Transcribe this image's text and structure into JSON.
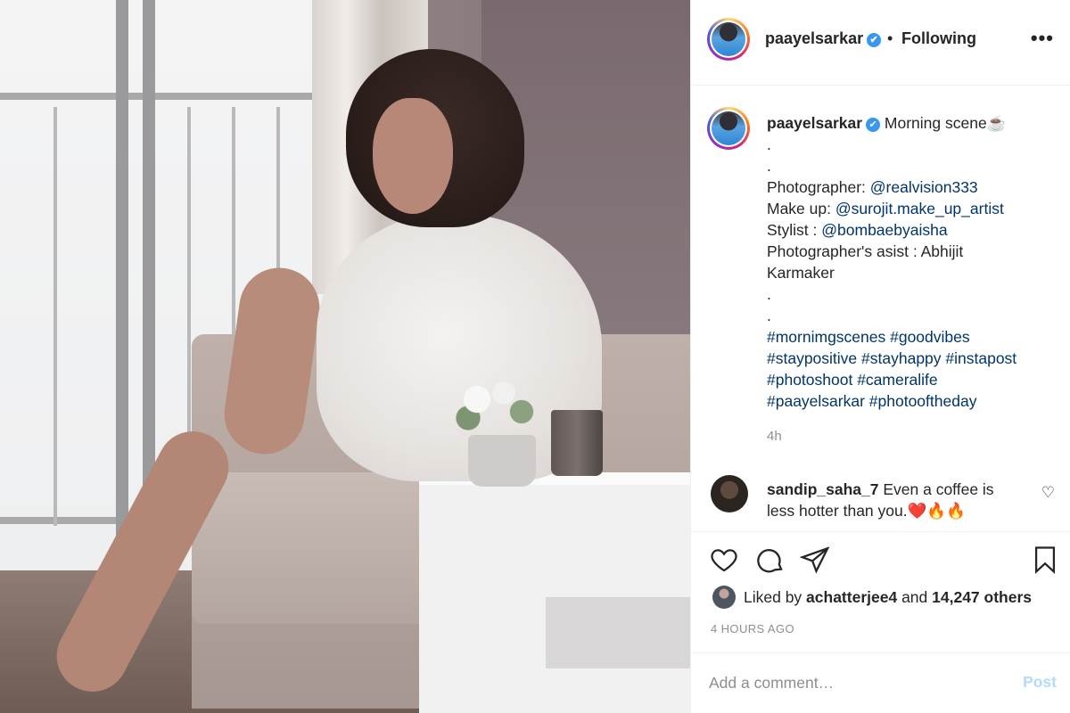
{
  "post": {
    "username": "paayelsarkar",
    "header_separator": "•",
    "follow_status": "Following",
    "more_label": "•••",
    "verified_mark": "✔"
  },
  "caption": {
    "username": "paayelsarkar",
    "title": " Morning scene☕",
    "lines": [
      ".",
      ".",
      "Photographer: ",
      "Make up: ",
      "Stylist : ",
      "Photographer's asist : Abhijit",
      "Karmaker",
      ".",
      ".",
      "#mornimgscenes #goodvibes",
      "#staypositive #stayhappy #instapost",
      "#photoshoot #cameralife",
      "#paayelsarkar #photooftheday"
    ],
    "mentions": {
      "photographer": "@realvision333",
      "makeup": "@surojit.make_up_artist",
      "stylist": "@bombaebyaisha"
    },
    "time": "4h"
  },
  "comment": {
    "username": "sandip_saha_7",
    "text": " Even a coffee is less hotter than you.❤️🔥🔥",
    "like_icon": "♡"
  },
  "engagement": {
    "liked_by_prefix": "Liked by ",
    "liked_by_user": "achatterjee4",
    "liked_by_mid": " and ",
    "others": "14,247 others",
    "timestamp": "4 HOURS AGO"
  },
  "add_comment": {
    "placeholder": "Add a comment…",
    "post_label": "Post"
  },
  "colors": {
    "link": "#003569",
    "verified": "#3897f0",
    "post_disabled": "#b3dbff",
    "muted": "#8e8e8e"
  },
  "icons": [
    "heart-icon",
    "comment-icon",
    "share-icon",
    "bookmark-icon",
    "verified-badge-icon",
    "more-options-icon"
  ]
}
